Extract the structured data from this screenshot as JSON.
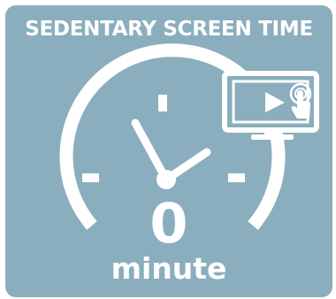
{
  "card": {
    "title": "SEDENTARY SCREEN TIME",
    "value": "0",
    "unit": "minute",
    "colors": {
      "background": "#8aaebe",
      "foreground": "#ffffff"
    },
    "icons": [
      "stopwatch-icon",
      "tv-touch-icon"
    ]
  }
}
